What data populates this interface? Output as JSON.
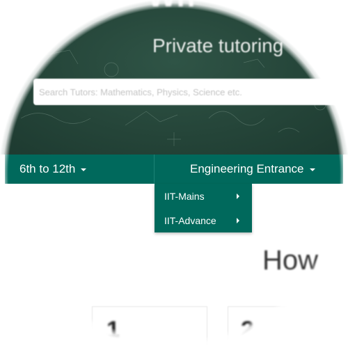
{
  "hero": {
    "title": "Wh",
    "subtitle": "Private tutoring",
    "search_placeholder": "Search Tutors: Mathematics, Physics, Science etc."
  },
  "menu": {
    "items": [
      {
        "label": "6th to 12th"
      },
      {
        "label": "Engineering Entrance"
      }
    ]
  },
  "dropdown": {
    "items": [
      {
        "label": "IIT-Mains"
      },
      {
        "label": "IIT-Advance"
      }
    ]
  },
  "section": {
    "heading": "How"
  },
  "cards": [
    {
      "glyph": "1"
    },
    {
      "glyph": "2"
    }
  ],
  "colors": {
    "menu_bg": "#00695c",
    "hero_bg": "#254539",
    "text_on_menu": "#ffffff"
  },
  "icons": {
    "menu_caret": "caret-down-icon",
    "submenu": "caret-right-icon"
  }
}
